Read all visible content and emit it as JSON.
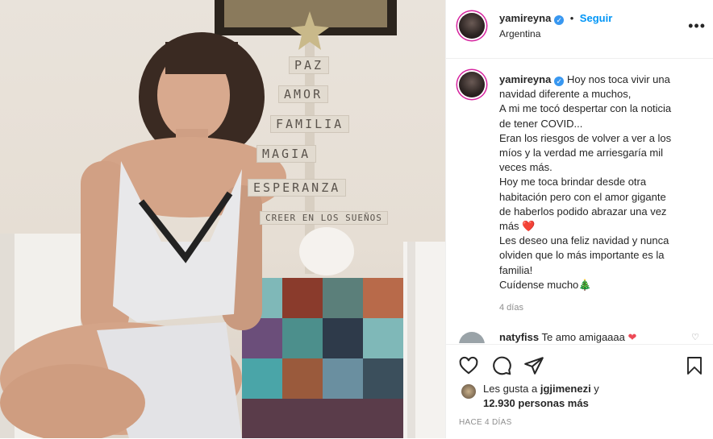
{
  "post": {
    "username": "yamireyna",
    "follow_label": "Seguir",
    "location": "Argentina",
    "more_label": "•••",
    "caption_lines": [
      "Hoy nos toca vivir una",
      "navidad diferente a muchos,",
      "A mi me tocó despertar con la noticia",
      "de tener COVID...",
      "Eran los riesgos de volver a ver a los",
      "míos y la verdad me arriesgaría mil",
      "veces más.",
      "Hoy me toca brindar desde otra",
      "habitación pero con el amor gigante",
      "de haberlos podido abrazar una vez",
      "más ❤️",
      "Les deseo una feliz navidad y nunca",
      "olviden que lo más importante es la",
      "familia!",
      "Cuídense mucho🎄"
    ],
    "time_ago": "4 días",
    "comment": {
      "username": "natyfiss",
      "text": "Te amo amigaaaa",
      "heart": "❤"
    },
    "likes": {
      "prefix": "Les gusta a ",
      "user": "jgjimenezi",
      "suffix": " y",
      "count_line": "12.930 personas más"
    },
    "posted_label": "HACE 4 DÍAS"
  },
  "photo": {
    "tree_words": [
      "PAZ",
      "AMOR",
      "FAMILIA",
      "MAGIA",
      "ESPERANZA",
      "CREER EN LOS SUEÑOS"
    ]
  },
  "icons": [
    "heart-icon",
    "comment-icon",
    "share-icon",
    "bookmark-icon",
    "verified-icon"
  ],
  "colors": {
    "follow": "#0095f6",
    "verified": "#3897f0",
    "heart": "#ed4956",
    "muted": "#8e8e8e"
  }
}
